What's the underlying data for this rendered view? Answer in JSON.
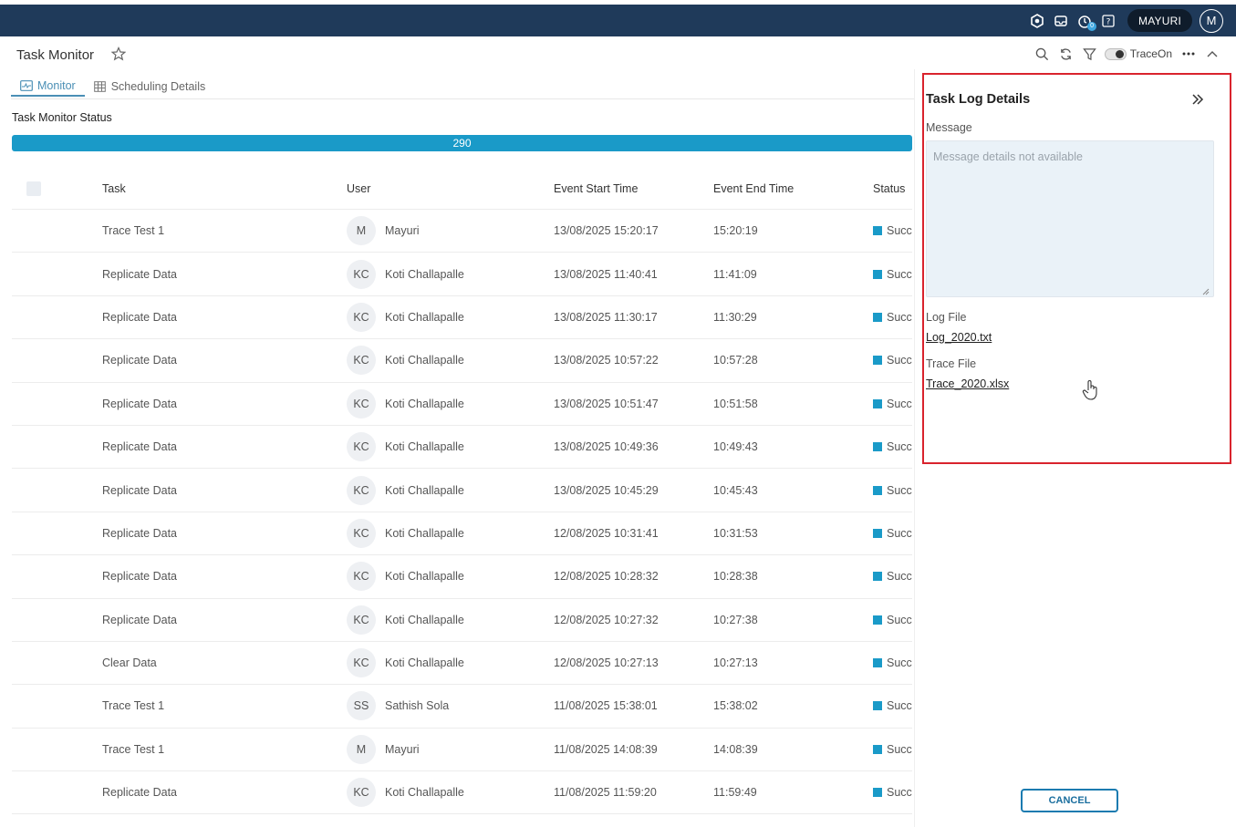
{
  "topbar": {
    "notification_count": "0",
    "user_label": "MAYURI",
    "avatar_initial": "M"
  },
  "header": {
    "title": "Task Monitor",
    "trace_label": "TraceOn"
  },
  "tabs": [
    {
      "label": "Monitor",
      "icon": "monitor-icon"
    },
    {
      "label": "Scheduling Details",
      "icon": "calendar-grid-icon"
    }
  ],
  "status": {
    "title": "Task Monitor Status",
    "count": "290",
    "fill_fraction": 1.0,
    "color": "#1a9ac8"
  },
  "table": {
    "columns": [
      "Task",
      "User",
      "Event Start Time",
      "Event End Time",
      "Status"
    ],
    "rows": [
      {
        "task": "Trace Test 1",
        "initials": "M",
        "user": "Mayuri",
        "start": "13/08/2025 15:20:17",
        "end": "15:20:19",
        "status": "Succe"
      },
      {
        "task": "Replicate Data",
        "initials": "KC",
        "user": "Koti Challapalle",
        "start": "13/08/2025 11:40:41",
        "end": "11:41:09",
        "status": "Succe"
      },
      {
        "task": "Replicate Data",
        "initials": "KC",
        "user": "Koti Challapalle",
        "start": "13/08/2025 11:30:17",
        "end": "11:30:29",
        "status": "Succe"
      },
      {
        "task": "Replicate Data",
        "initials": "KC",
        "user": "Koti Challapalle",
        "start": "13/08/2025 10:57:22",
        "end": "10:57:28",
        "status": "Succe"
      },
      {
        "task": "Replicate Data",
        "initials": "KC",
        "user": "Koti Challapalle",
        "start": "13/08/2025 10:51:47",
        "end": "10:51:58",
        "status": "Succe"
      },
      {
        "task": "Replicate Data",
        "initials": "KC",
        "user": "Koti Challapalle",
        "start": "13/08/2025 10:49:36",
        "end": "10:49:43",
        "status": "Succe"
      },
      {
        "task": "Replicate Data",
        "initials": "KC",
        "user": "Koti Challapalle",
        "start": "13/08/2025 10:45:29",
        "end": "10:45:43",
        "status": "Succe"
      },
      {
        "task": "Replicate Data",
        "initials": "KC",
        "user": "Koti Challapalle",
        "start": "12/08/2025 10:31:41",
        "end": "10:31:53",
        "status": "Succe"
      },
      {
        "task": "Replicate Data",
        "initials": "KC",
        "user": "Koti Challapalle",
        "start": "12/08/2025 10:28:32",
        "end": "10:28:38",
        "status": "Succe"
      },
      {
        "task": "Replicate Data",
        "initials": "KC",
        "user": "Koti Challapalle",
        "start": "12/08/2025 10:27:32",
        "end": "10:27:38",
        "status": "Succe"
      },
      {
        "task": "Clear Data",
        "initials": "KC",
        "user": "Koti Challapalle",
        "start": "12/08/2025 10:27:13",
        "end": "10:27:13",
        "status": "Succe"
      },
      {
        "task": "Trace Test 1",
        "initials": "SS",
        "user": "Sathish Sola",
        "start": "11/08/2025 15:38:01",
        "end": "15:38:02",
        "status": "Succe"
      },
      {
        "task": "Trace Test 1",
        "initials": "M",
        "user": "Mayuri",
        "start": "11/08/2025 14:08:39",
        "end": "14:08:39",
        "status": "Succe"
      },
      {
        "task": "Replicate Data",
        "initials": "KC",
        "user": "Koti Challapalle",
        "start": "11/08/2025 11:59:20",
        "end": "11:59:49",
        "status": "Succe"
      }
    ]
  },
  "panel": {
    "title": "Task Log Details",
    "message_label": "Message",
    "message_placeholder": "Message details not available",
    "log_file_label": "Log File",
    "log_file": "Log_2020.txt",
    "trace_file_label": "Trace File",
    "trace_file": "Trace_2020.xlsx",
    "cancel_label": "CANCEL",
    "highlight_color": "#d9232d"
  }
}
